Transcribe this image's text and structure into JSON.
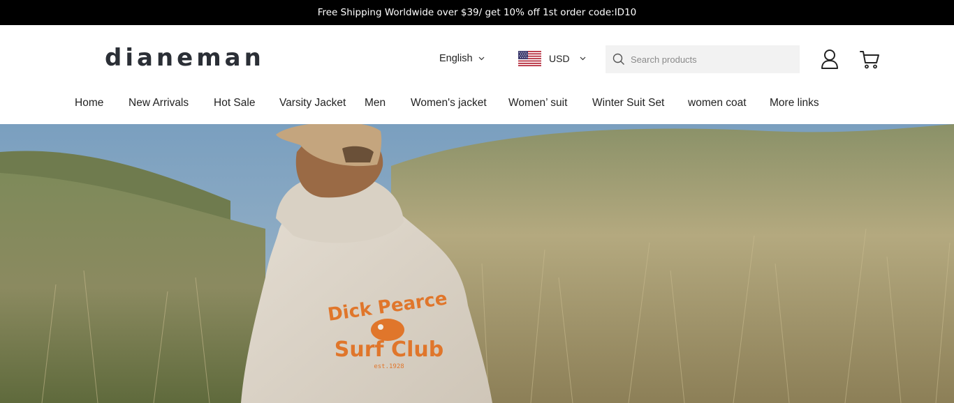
{
  "announcement": "Free Shipping Worldwide over $39/ get 10% off 1st order code:ID10",
  "header": {
    "logo": "dianeman",
    "language": "English",
    "currency": "USD",
    "search_placeholder": "Search products"
  },
  "nav": {
    "items": [
      {
        "label": "Home"
      },
      {
        "label": "New Arrivals"
      },
      {
        "label": "Hot Sale"
      },
      {
        "label": "Varsity Jacket"
      },
      {
        "label": "Men"
      },
      {
        "label": "Women's jacket"
      },
      {
        "label": "Women’ suit"
      },
      {
        "label": "Winter Suit Set"
      },
      {
        "label": "women coat"
      },
      {
        "label": "More links"
      }
    ]
  },
  "hero": {
    "print_line1": "Dick Pearce",
    "print_line2": "Surf Club",
    "print_line3": "est.1928"
  },
  "icons": {
    "flag": "us-flag-icon",
    "search": "search-icon",
    "account": "user-icon",
    "cart": "cart-icon"
  },
  "colors": {
    "announcement_bg": "#000000",
    "logo": "#2b2f36",
    "search_bg": "#f2f2f2",
    "print_orange": "#e0762b"
  }
}
